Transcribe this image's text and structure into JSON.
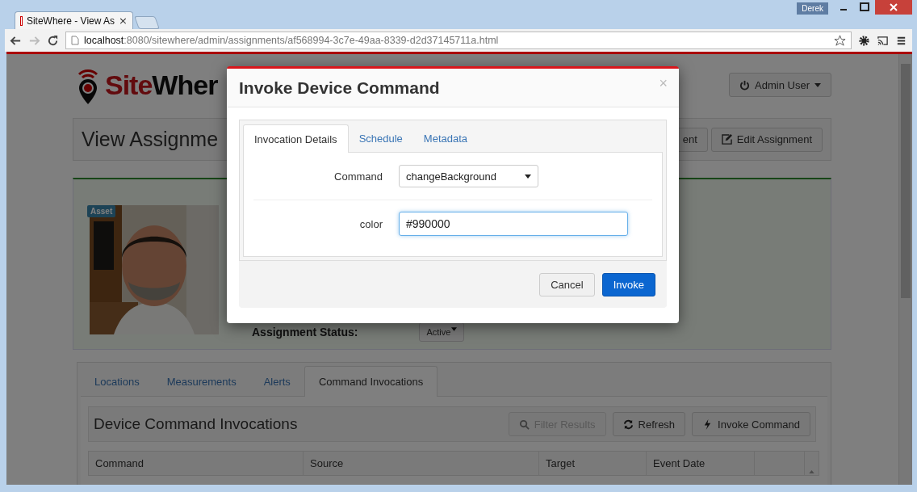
{
  "browser": {
    "tab_title": "SiteWhere - View As",
    "tab_close": "×",
    "user": "Derek",
    "url_host": "localhost",
    "url_rest": ":8080/sitewhere/admin/assignments/af568994-3c7e-49aa-8339-d2d37145711a.html"
  },
  "page": {
    "logo_words": [
      "Site",
      "Wher"
    ],
    "user_menu": "Admin User",
    "page_title": "View Assignme",
    "header_buttons": [
      {
        "label": "ent",
        "kind": "plain"
      },
      {
        "label": "Edit Assignment",
        "kind": "edit"
      }
    ],
    "asset_badge": "Asset",
    "status_label": "Assignment Status:",
    "status_value": "Active",
    "tabs": [
      {
        "label": "Locations",
        "selected": false
      },
      {
        "label": "Measurements",
        "selected": false
      },
      {
        "label": "Alerts",
        "selected": false
      },
      {
        "label": "Command Invocations",
        "selected": true
      }
    ],
    "section_title": "Device Command Invocations",
    "toolbar_buttons": [
      {
        "label": "Filter Results",
        "kind": "search",
        "disabled": true
      },
      {
        "label": "Refresh",
        "kind": "refresh",
        "disabled": false
      },
      {
        "label": "Invoke Command",
        "kind": "bolt",
        "disabled": false
      }
    ],
    "table": {
      "columns": [
        "Command",
        "Source",
        "Target",
        "Event Date"
      ]
    }
  },
  "modal": {
    "title": "Invoke Device Command",
    "close": "×",
    "tabs": [
      {
        "label": "Invocation Details",
        "selected": true
      },
      {
        "label": "Schedule",
        "selected": false
      },
      {
        "label": "Metadata",
        "selected": false
      }
    ],
    "fields": [
      {
        "kind": "select",
        "label": "Command",
        "value": "changeBackground"
      },
      {
        "kind": "input",
        "label": "color",
        "value": "#990000"
      }
    ],
    "buttons": [
      {
        "label": "Cancel",
        "kind": "default"
      },
      {
        "label": "Invoke",
        "kind": "primary"
      }
    ]
  }
}
